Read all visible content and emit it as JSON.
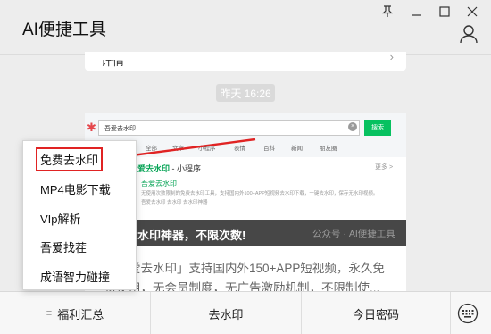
{
  "window": {
    "title": "AI便捷工具"
  },
  "previous_card": {
    "text": "详情"
  },
  "timestamp": "昨天 16:26",
  "article": {
    "mock_page": {
      "search_query": "吾爱去水印",
      "search_button": "搜索",
      "categories": [
        "全部",
        "文章",
        "小程序",
        "表情",
        "百科",
        "新闻",
        "朋友圈"
      ],
      "mini_program_title": "吾爱去水印",
      "mini_program_suffix": " - 小程序",
      "more": "更多 >",
      "result_name": "吾爱去水印",
      "result_desc": "无使用次数限制的免费去水印工具，支持国内外100+APP短视频去水印下载，一键去水印，保存无水印视频。",
      "result_desc2": "吾爱去水印    去水印    去水印神器"
    },
    "banner_text": "去水印神器，不限次数!",
    "watermark": "公众号 · AI便捷工具",
    "summary": "「吾爱去水印」支持国内外150+APP短视频，永久免费使用，无会员制度，无广告激励机制，不限制使..."
  },
  "popup_menu": {
    "items": [
      {
        "label": "免费去水印",
        "highlighted": true
      },
      {
        "label": "MP4电影下载",
        "highlighted": false
      },
      {
        "label": "VIp解析",
        "highlighted": false
      },
      {
        "label": "吾爱找茬",
        "highlighted": false
      },
      {
        "label": "成语智力碰撞",
        "highlighted": false
      }
    ]
  },
  "bottom_menu": {
    "items": [
      {
        "label": "福利汇总",
        "icon": "hamburger-icon"
      },
      {
        "label": "去水印"
      },
      {
        "label": "今日密码"
      }
    ],
    "keyboard_icon": "keyboard-icon"
  },
  "colors": {
    "accent_green": "#07c160",
    "annotation_red": "#e02323",
    "background": "#ededed"
  }
}
